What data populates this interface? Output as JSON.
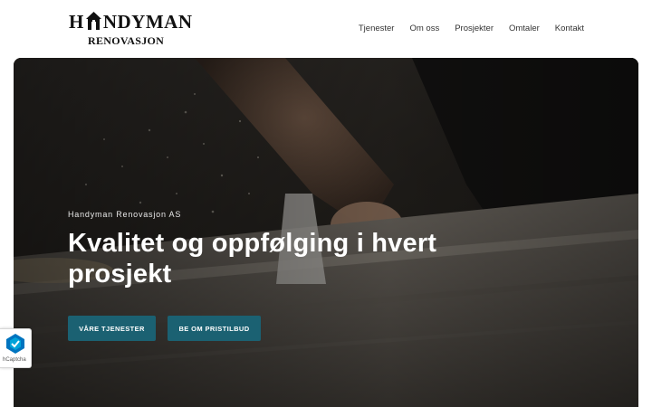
{
  "logo": {
    "line1_left": "H",
    "line1_right": "NDYMAN",
    "line2": "RENOVASJON",
    "icon": "house-icon"
  },
  "nav": {
    "items": [
      "Tjenester",
      "Om oss",
      "Prosjekter",
      "Omtaler",
      "Kontakt"
    ]
  },
  "hero": {
    "subtitle": "Handyman Renovasjon AS",
    "title": "Kvalitet og oppfølging i hvert prosjekt",
    "buttons": [
      "VÅRE TJENESTER",
      "BE OM PRISTILBUD"
    ],
    "background": "woodworking-table-saw-photo"
  },
  "captcha": {
    "label": "hCaptcha",
    "icon": "hcaptcha-icon"
  },
  "colors": {
    "accent": "#1b6172",
    "text_dark": "#111111",
    "nav_text": "#333333"
  }
}
